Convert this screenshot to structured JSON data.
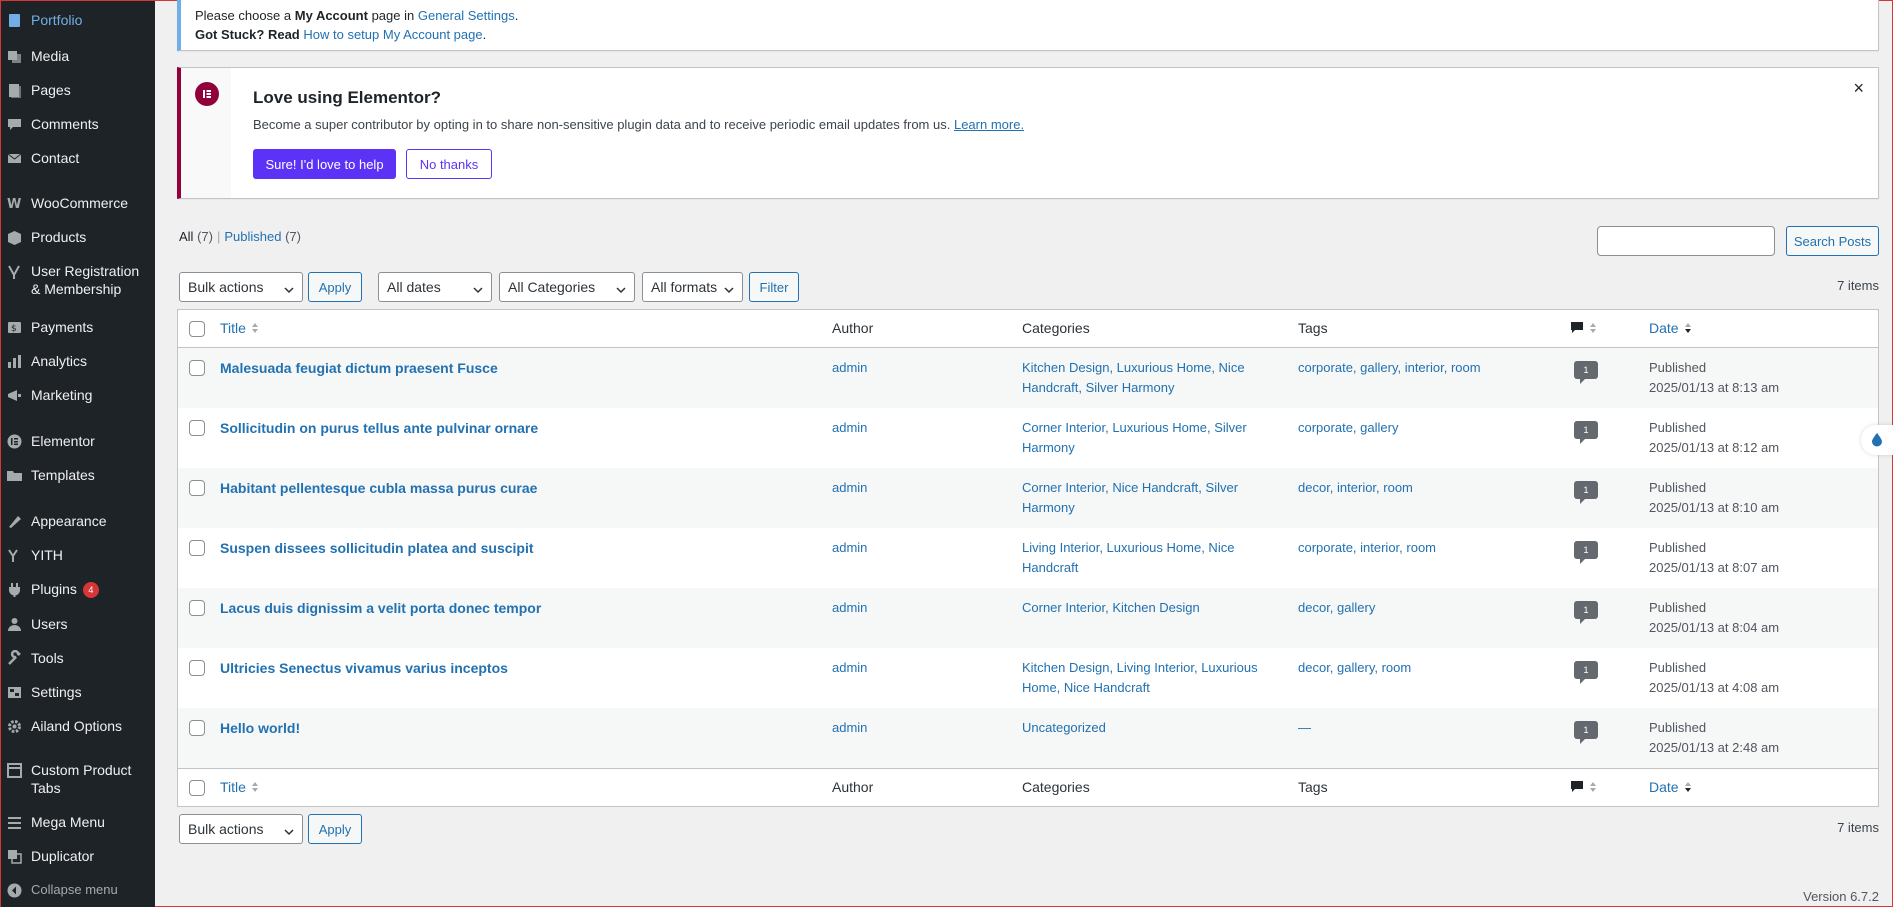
{
  "sidebar": {
    "items": [
      {
        "label": "Portfolio",
        "icon": "portfolio-icon"
      },
      {
        "label": "Media",
        "icon": "media-icon"
      },
      {
        "label": "Pages",
        "icon": "pages-icon"
      },
      {
        "label": "Comments",
        "icon": "comments-icon"
      },
      {
        "label": "Contact",
        "icon": "contact-icon"
      },
      {
        "label": "WooCommerce",
        "icon": "woocommerce-icon"
      },
      {
        "label": "Products",
        "icon": "products-icon"
      },
      {
        "label": "User Registration & Membership",
        "icon": "user-registration-icon"
      },
      {
        "label": "Payments",
        "icon": "payments-icon"
      },
      {
        "label": "Analytics",
        "icon": "analytics-icon"
      },
      {
        "label": "Marketing",
        "icon": "marketing-icon"
      },
      {
        "label": "Elementor",
        "icon": "elementor-icon"
      },
      {
        "label": "Templates",
        "icon": "templates-icon"
      },
      {
        "label": "Appearance",
        "icon": "appearance-icon"
      },
      {
        "label": "YITH",
        "icon": "yith-icon"
      },
      {
        "label": "Plugins",
        "icon": "plugins-icon",
        "badge": "4"
      },
      {
        "label": "Users",
        "icon": "users-icon"
      },
      {
        "label": "Tools",
        "icon": "tools-icon"
      },
      {
        "label": "Settings",
        "icon": "settings-icon"
      },
      {
        "label": "Ailand Options",
        "icon": "gear-icon"
      },
      {
        "label": "Custom Product Tabs",
        "icon": "tabs-icon"
      },
      {
        "label": "Mega Menu",
        "icon": "mega-menu-icon"
      },
      {
        "label": "Duplicator",
        "icon": "duplicator-icon"
      },
      {
        "label": "Collapse menu",
        "icon": "collapse-icon"
      }
    ]
  },
  "account_notice": {
    "line1_prefix": "Please choose a",
    "line1_bold": "My Account",
    "line1_mid": "page in",
    "line1_link": "General Settings",
    "line1_suffix": ".",
    "line2_prefix": "Got Stuck? Read",
    "line2_link": "How to setup My Account page",
    "line2_suffix": "."
  },
  "elementor_notice": {
    "title": "Love using Elementor?",
    "description": "Become a super contributor by opting in to share non-sensitive plugin data and to receive periodic email updates from us.",
    "learn_more": "Learn more.",
    "primary_button": "Sure! I'd love to help",
    "secondary_button": "No thanks",
    "close": "×"
  },
  "filters": {
    "all_label": "All",
    "all_count": "(7)",
    "separator": "|",
    "published_label": "Published",
    "published_count": "(7)",
    "search_button": "Search Posts",
    "search_placeholder": "",
    "bulk_actions": "Bulk actions",
    "apply": "Apply",
    "dates": "All dates",
    "categories": "All Categories",
    "formats": "All formats",
    "filter": "Filter",
    "items_count": "7 items"
  },
  "table": {
    "headers": {
      "title": "Title",
      "author": "Author",
      "categories": "Categories",
      "tags": "Tags",
      "date": "Date"
    },
    "rows": [
      {
        "title": "Malesuada feugiat dictum praesent Fusce",
        "author": "admin",
        "categories": "Kitchen Design, Luxurious Home, Nice Handcraft, Silver Harmony",
        "tags": "corporate, gallery, interior, room",
        "comments": "1",
        "status": "Published",
        "date": "2025/01/13 at 8:13 am"
      },
      {
        "title": "Sollicitudin on purus tellus ante pulvinar ornare",
        "author": "admin",
        "categories": "Corner Interior, Luxurious Home, Silver Harmony",
        "tags": "corporate, gallery",
        "comments": "1",
        "status": "Published",
        "date": "2025/01/13 at 8:12 am"
      },
      {
        "title": "Habitant pellentesque cubla massa purus curae",
        "author": "admin",
        "categories": "Corner Interior, Nice Handcraft, Silver Harmony",
        "tags": "decor, interior, room",
        "comments": "1",
        "status": "Published",
        "date": "2025/01/13 at 8:10 am"
      },
      {
        "title": "Suspen dissees sollicitudin platea and suscipit",
        "author": "admin",
        "categories": "Living Interior, Luxurious Home, Nice Handcraft",
        "tags": "corporate, interior, room",
        "comments": "1",
        "status": "Published",
        "date": "2025/01/13 at 8:07 am"
      },
      {
        "title": "Lacus duis dignissim a velit porta donec tempor",
        "author": "admin",
        "categories": "Corner Interior, Kitchen Design",
        "tags": "decor, gallery",
        "comments": "1",
        "status": "Published",
        "date": "2025/01/13 at 8:04 am"
      },
      {
        "title": "Ultricies Senectus vivamus varius inceptos",
        "author": "admin",
        "categories": "Kitchen Design, Living Interior, Luxurious Home, Nice Handcraft",
        "tags": "decor, gallery, room",
        "comments": "1",
        "status": "Published",
        "date": "2025/01/13 at 4:08 am"
      },
      {
        "title": "Hello world!",
        "author": "admin",
        "categories": "Uncategorized",
        "tags": "—",
        "comments": "1",
        "status": "Published",
        "date": "2025/01/13 at 2:48 am"
      }
    ]
  },
  "footer": {
    "version": "Version 6.7.2"
  },
  "colors": {
    "sidebar_bg": "#1d2327",
    "link": "#2271b1",
    "elementor_accent": "#93003c",
    "elementor_button": "#5c33f6",
    "badge": "#d63638"
  }
}
